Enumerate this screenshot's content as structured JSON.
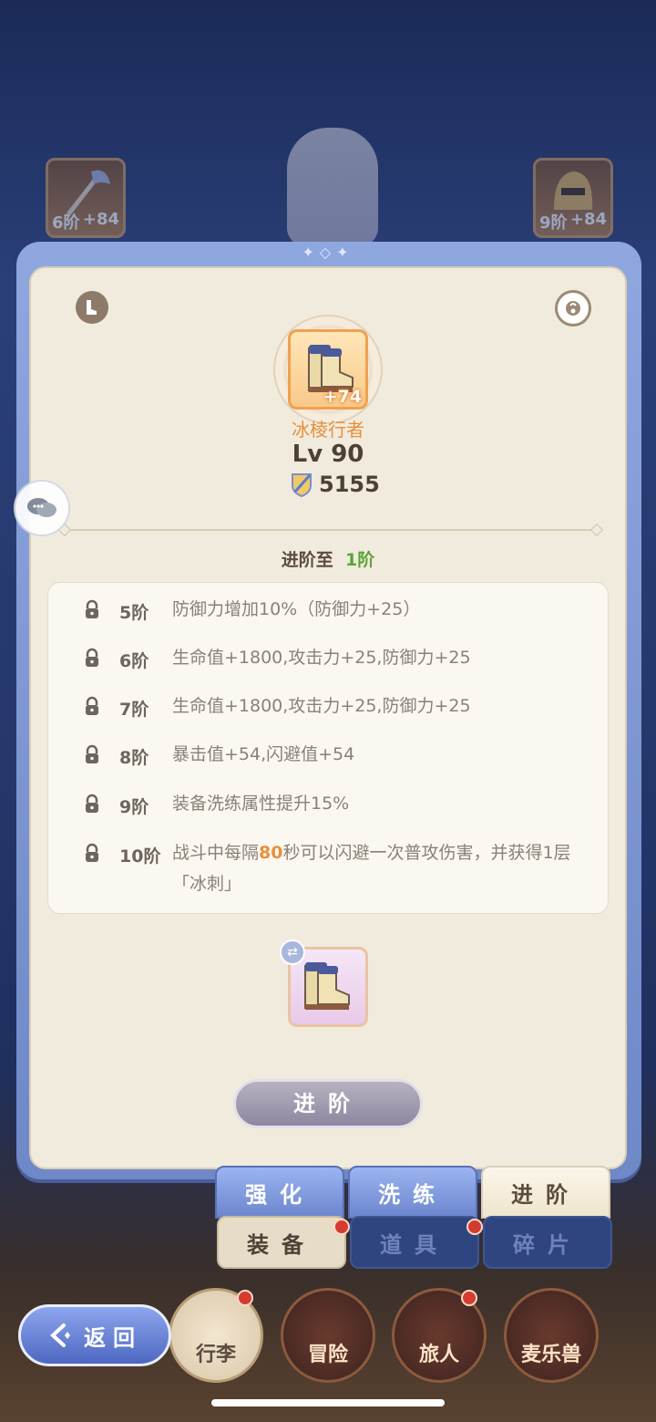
{
  "background": {
    "left_slot": {
      "tier": "6阶",
      "plus": "+84"
    },
    "right_slot": {
      "tier": "9阶",
      "plus": "+84"
    }
  },
  "item": {
    "plus": "+74",
    "name": "冰棱行者",
    "level": "Lv 90",
    "power": "5155"
  },
  "advance": {
    "prefix": "进阶至",
    "target": "1阶"
  },
  "tiers": [
    {
      "tier": "5阶",
      "desc": "防御力增加10%（防御力+25）"
    },
    {
      "tier": "6阶",
      "desc": "生命值+1800,攻击力+25,防御力+25"
    },
    {
      "tier": "7阶",
      "desc": "生命值+1800,攻击力+25,防御力+25"
    },
    {
      "tier": "8阶",
      "desc": "暴击值+54,闪避值+54"
    },
    {
      "tier": "9阶",
      "desc": "装备洗练属性提升15%"
    },
    {
      "tier": "10阶",
      "desc_before": "战斗中每隔",
      "desc_highlight": "80",
      "desc_after": "秒可以闪避一次普攻伤害，并获得1层「冰刺」"
    }
  ],
  "advance_button": "进阶",
  "tabs": [
    "强化",
    "洗练",
    "进阶"
  ],
  "subtabs": [
    "装备",
    "道具",
    "碎片"
  ],
  "bottom_nav": [
    "行李",
    "冒险",
    "旅人",
    "麦乐兽"
  ],
  "back_button": "返回",
  "colors": {
    "accent_orange": "#e8903b",
    "green": "#5ba33a",
    "tab_blue": "#7d97dd",
    "panel_bg": "#f1ebde"
  },
  "icons": [
    "boots-icon",
    "help-icon",
    "shield-sword-icon",
    "lock-icon",
    "swap-icon",
    "chat-icon",
    "back-arrow-icon"
  ]
}
